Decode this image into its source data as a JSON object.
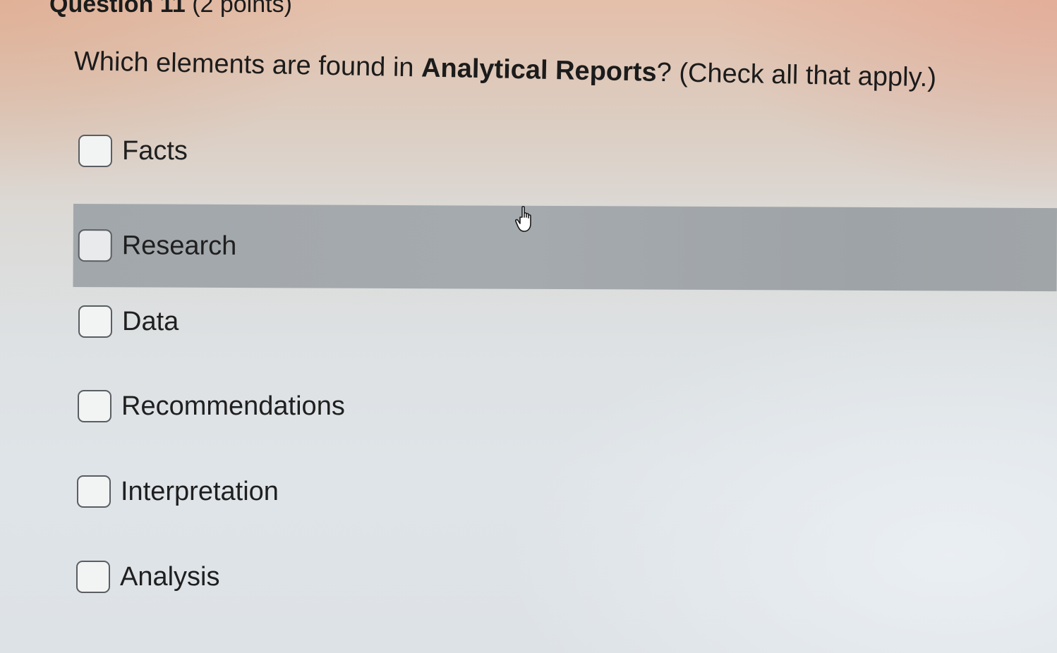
{
  "question": {
    "number_label": "Question 11",
    "points_label": "(2 points)",
    "prompt_before": "Which elements are found in ",
    "prompt_bold": "Analytical Reports",
    "prompt_after": "? (Check all that apply.)"
  },
  "options": [
    {
      "label": "Facts",
      "checked": false
    },
    {
      "label": "Research",
      "checked": false,
      "hovered": true
    },
    {
      "label": "Data",
      "checked": false
    },
    {
      "label": "Recommendations",
      "checked": false
    },
    {
      "label": "Interpretation",
      "checked": false
    },
    {
      "label": "Analysis",
      "checked": false
    }
  ],
  "cursor": {
    "icon": "hand-pointer-icon"
  },
  "colors": {
    "hover_row": "#a3a8ac",
    "checkbox_border": "#5a5e62",
    "text": "#1b1b1b"
  }
}
